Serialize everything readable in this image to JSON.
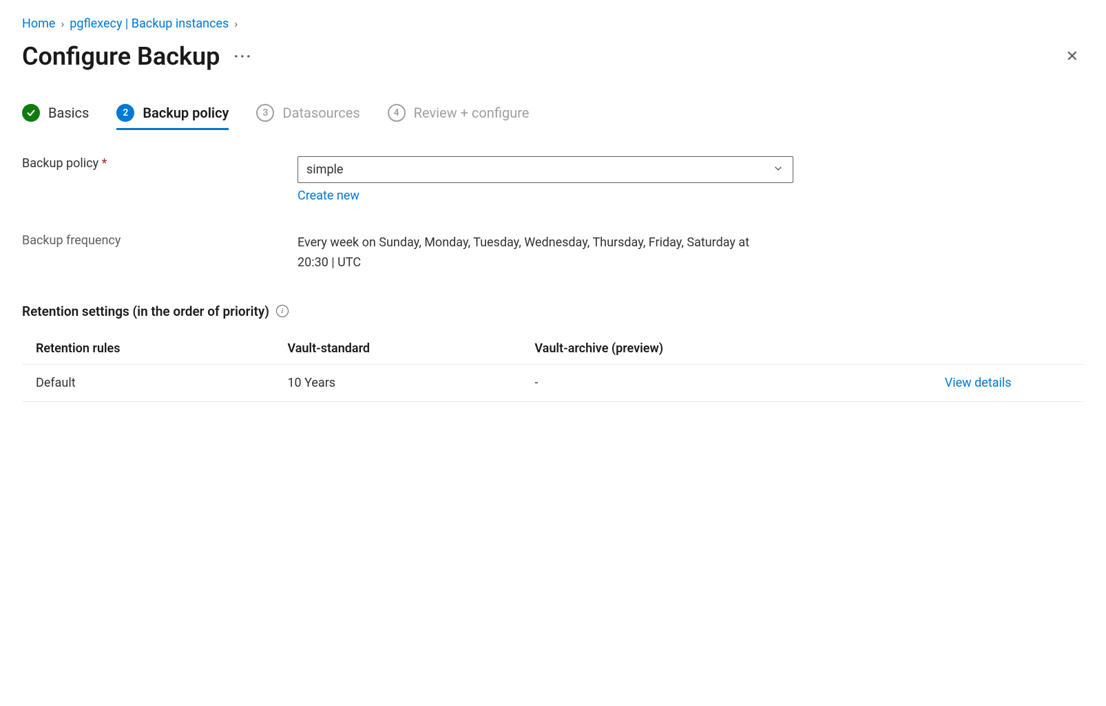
{
  "breadcrumb": {
    "home": "Home",
    "vault": "pgflexecy | Backup instances"
  },
  "header": {
    "title": "Configure Backup",
    "ellipsis": "···"
  },
  "tabs": {
    "basics": "Basics",
    "backup_policy": "Backup policy",
    "datasources_num": "3",
    "datasources": "Datasources",
    "review_num": "4",
    "review": "Review + configure",
    "current_num": "2"
  },
  "form": {
    "backup_policy_label": "Backup policy",
    "backup_policy_value": "simple",
    "create_new": "Create new",
    "frequency_label": "Backup frequency",
    "frequency_value": "Every week on Sunday, Monday, Tuesday, Wednesday, Thursday, Friday, Saturday at 20:30 | UTC"
  },
  "retention": {
    "heading": "Retention settings (in the order of priority)",
    "columns": {
      "rules": "Retention rules",
      "standard": "Vault-standard",
      "archive": "Vault-archive (preview)"
    },
    "rows": [
      {
        "name": "Default",
        "standard": "10 Years",
        "archive": "-",
        "action": "View details"
      }
    ]
  }
}
